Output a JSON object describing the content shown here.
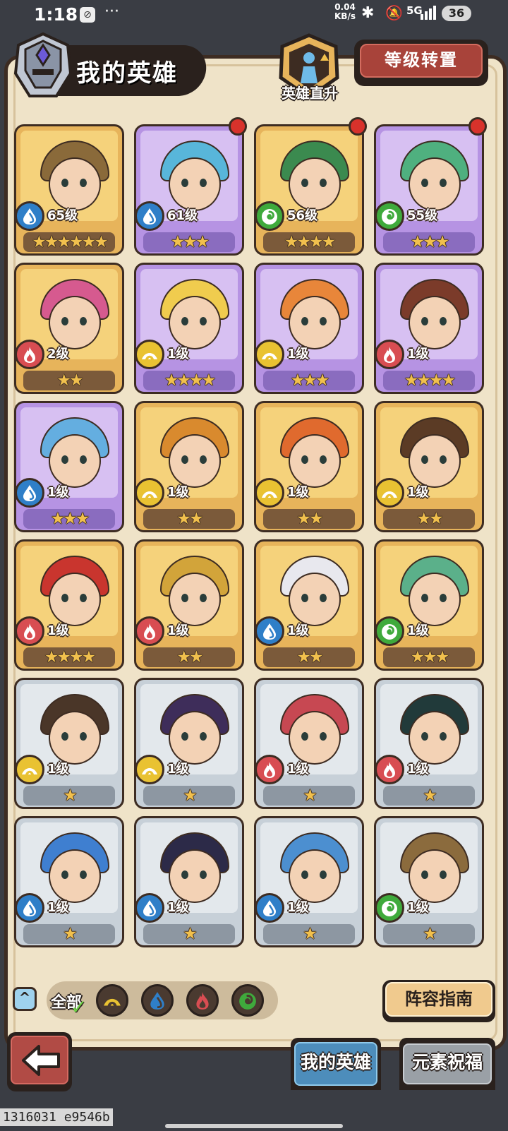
{
  "status_bar": {
    "time": "1:18",
    "network_speed_value": "0.04",
    "network_speed_unit": "KB/s",
    "signal": "5G",
    "battery": "36"
  },
  "header": {
    "title": "我的英雄",
    "promo_label": "英雄直升",
    "reset_button": "等级转置"
  },
  "colors": {
    "water": "#2f7fc8",
    "light": "#e9c232",
    "fire": "#d84d52",
    "wind": "#3faa3c",
    "frame_gold": "#e7b45b",
    "frame_purple": "#b693e3",
    "frame_silver": "#c7d0d8"
  },
  "heroes": [
    {
      "level": "65级",
      "element": "water",
      "stars": "★★★★★★",
      "rarity": "gold",
      "red_dot": false
    },
    {
      "level": "61级",
      "element": "water",
      "stars": "★★★",
      "rarity": "purple",
      "red_dot": true
    },
    {
      "level": "56级",
      "element": "wind",
      "stars": "★★★★",
      "rarity": "gold",
      "red_dot": true
    },
    {
      "level": "55级",
      "element": "wind",
      "stars": "★★★",
      "rarity": "purple",
      "red_dot": true
    },
    {
      "level": "2级",
      "element": "fire",
      "stars": "★★",
      "rarity": "gold",
      "red_dot": false
    },
    {
      "level": "1级",
      "element": "light",
      "stars": "★★★★",
      "rarity": "purple",
      "red_dot": false
    },
    {
      "level": "1级",
      "element": "light",
      "stars": "★★★",
      "rarity": "purple",
      "red_dot": false
    },
    {
      "level": "1级",
      "element": "fire",
      "stars": "★★★★",
      "rarity": "purple",
      "red_dot": false
    },
    {
      "level": "1级",
      "element": "water",
      "stars": "★★★",
      "rarity": "purple",
      "red_dot": false
    },
    {
      "level": "1级",
      "element": "light",
      "stars": "★★",
      "rarity": "gold",
      "red_dot": false
    },
    {
      "level": "1级",
      "element": "light",
      "stars": "★★",
      "rarity": "gold",
      "red_dot": false
    },
    {
      "level": "1级",
      "element": "light",
      "stars": "★★",
      "rarity": "gold",
      "red_dot": false
    },
    {
      "level": "1级",
      "element": "fire",
      "stars": "★★★★",
      "rarity": "gold",
      "red_dot": false
    },
    {
      "level": "1级",
      "element": "fire",
      "stars": "★★",
      "rarity": "gold",
      "red_dot": false
    },
    {
      "level": "1级",
      "element": "water",
      "stars": "★★",
      "rarity": "gold",
      "red_dot": false
    },
    {
      "level": "1级",
      "element": "wind",
      "stars": "★★★",
      "rarity": "gold",
      "red_dot": false
    },
    {
      "level": "1级",
      "element": "light",
      "stars": "★",
      "rarity": "silver",
      "red_dot": false
    },
    {
      "level": "1级",
      "element": "light",
      "stars": "★",
      "rarity": "silver",
      "red_dot": false
    },
    {
      "level": "1级",
      "element": "fire",
      "stars": "★",
      "rarity": "silver",
      "red_dot": false
    },
    {
      "level": "1级",
      "element": "fire",
      "stars": "★",
      "rarity": "silver",
      "red_dot": false
    },
    {
      "level": "1级",
      "element": "water",
      "stars": "★",
      "rarity": "silver",
      "red_dot": false
    },
    {
      "level": "1级",
      "element": "water",
      "stars": "★",
      "rarity": "silver",
      "red_dot": false
    },
    {
      "level": "1级",
      "element": "water",
      "stars": "★",
      "rarity": "silver",
      "red_dot": false
    },
    {
      "level": "1级",
      "element": "wind",
      "stars": "★",
      "rarity": "silver",
      "red_dot": false
    }
  ],
  "filter": {
    "all_label": "全部",
    "elements": [
      "light",
      "water",
      "fire",
      "wind"
    ]
  },
  "guide_button": "阵容指南",
  "tabs": {
    "my_heroes": "我的英雄",
    "element_blessing": "元素祝福"
  },
  "version": "1316031 e9546b"
}
